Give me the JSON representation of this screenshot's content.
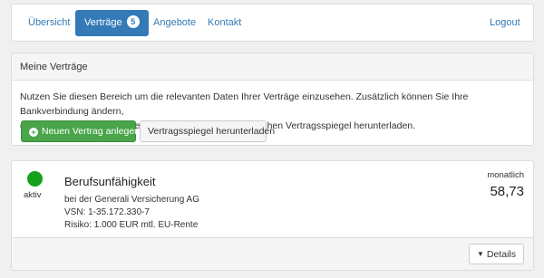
{
  "nav": {
    "overview": "Übersicht",
    "contracts": "Verträge",
    "contracts_badge": "5",
    "offers": "Angebote",
    "contact": "Kontakt",
    "logout": "Logout"
  },
  "contracts_panel": {
    "heading": "Meine Verträge",
    "text_line1": "Nutzen Sie diesen Bereich um die relevanten Daten Ihrer Verträge einzusehen. Zusätzlich können Sie Ihre Bankverbindung ändern,",
    "text_line2": "ein Kündigungsschreiben generieren sowie Ihren persönlichen Vertragsspiegel herunterladen.",
    "btn_new": "Neuen Vertrag anlegen",
    "btn_download": "Vertragsspiegel herunterladen"
  },
  "contract": {
    "status_color": "#15a11c",
    "status": "aktiv",
    "title": "Berufsunfähigkeit",
    "insurer": "bei der Generali Versicherung AG",
    "vsn": "VSN: 1-35.172.330-7",
    "risk": "Risiko: 1.000 EUR mtl. EU-Rente",
    "period": "monatlich",
    "amount": "58,73",
    "details_label": "Details"
  },
  "icons": {
    "new_contract": "plus-circle-icon",
    "details": "chevron-down-icon"
  }
}
